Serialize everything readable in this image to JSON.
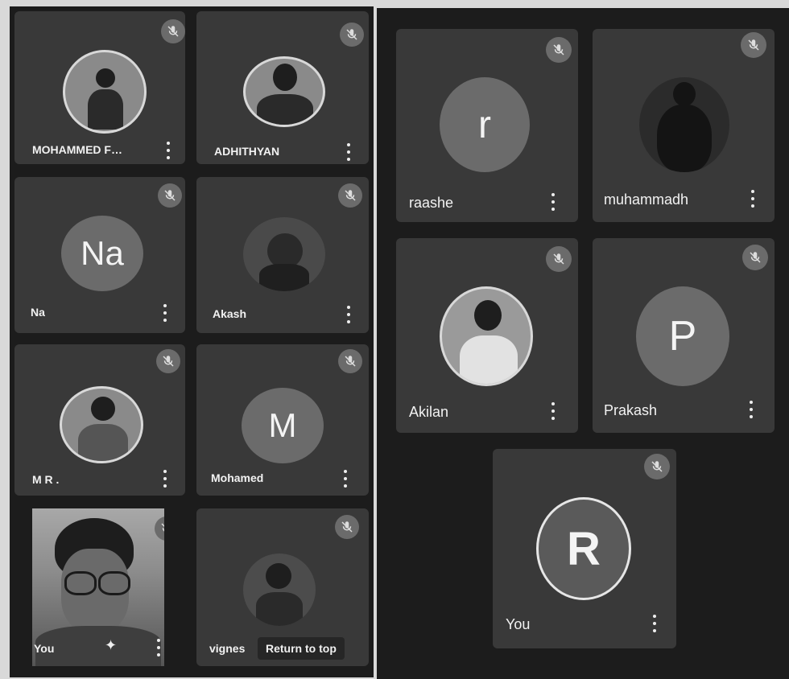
{
  "left_grid": {
    "tiles": [
      {
        "name": "MOHAMMED F…",
        "avatar_type": "photo"
      },
      {
        "name": "ADHITHYAN",
        "avatar_type": "photo"
      },
      {
        "name": "Na",
        "avatar_type": "initials",
        "initials": "Na"
      },
      {
        "name": "Akash",
        "avatar_type": "photo"
      },
      {
        "name": "M R .",
        "avatar_type": "photo"
      },
      {
        "name": "Mohamed",
        "avatar_type": "initials",
        "initials": "M"
      },
      {
        "name": "You",
        "avatar_type": "camera",
        "effects_icon": "sparkle-icon"
      },
      {
        "name": "vignes",
        "avatar_type": "photo"
      }
    ],
    "return_to_top_label": "Return to top"
  },
  "right_grid": {
    "tiles": [
      {
        "name": "raashe",
        "avatar_type": "initials",
        "initials": "r"
      },
      {
        "name": "muhammadh",
        "avatar_type": "photo"
      },
      {
        "name": "Akilan",
        "avatar_type": "photo"
      },
      {
        "name": "Prakash",
        "avatar_type": "initials",
        "initials": "P"
      },
      {
        "name": "You",
        "avatar_type": "initials",
        "initials": "R"
      }
    ]
  },
  "icons": {
    "muted": "mic-off-icon",
    "more": "more-vert-icon"
  },
  "colors": {
    "background": "#1c1c1c",
    "tile": "#393939",
    "mic_badge": "#6b6b6b"
  }
}
